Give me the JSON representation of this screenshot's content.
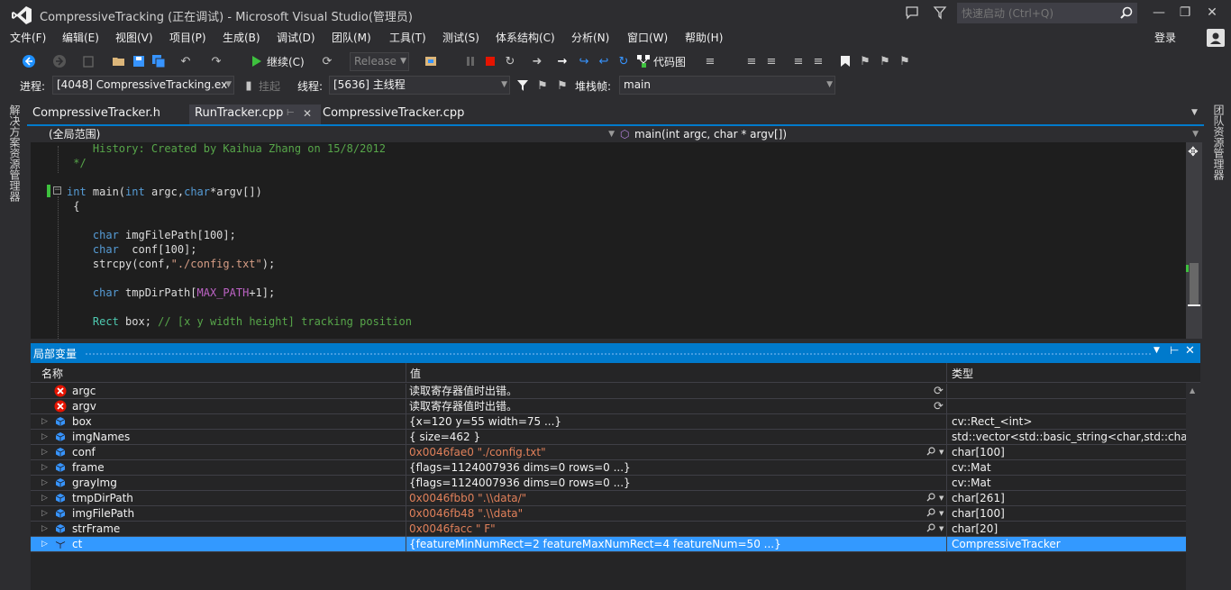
{
  "window": {
    "title": "CompressiveTracking (正在调试) - Microsoft Visual Studio(管理员)",
    "quick_launch_placeholder": "快速启动 (Ctrl+Q)",
    "login": "登录"
  },
  "menu": [
    "文件(F)",
    "编辑(E)",
    "视图(V)",
    "项目(P)",
    "生成(B)",
    "调试(D)",
    "团队(M)",
    "工具(T)",
    "测试(S)",
    "体系结构(C)",
    "分析(N)",
    "窗口(W)",
    "帮助(H)"
  ],
  "toolbar1": {
    "continue_label": "继续(C)",
    "config": "Release",
    "code_map": "代码图"
  },
  "toolbar2": {
    "process_label": "进程:",
    "process_value": "[4048] CompressiveTracking.ex",
    "suspend_label": "挂起",
    "thread_label": "线程:",
    "thread_value": "[5636] 主线程",
    "stack_label": "堆栈帧:",
    "stack_value": "main"
  },
  "side_panels": {
    "left": "解决方案资源管理器",
    "right": "团队资源管理器"
  },
  "tabs": [
    "CompressiveTracker.h",
    "RunTracker.cpp",
    "CompressiveTracker.cpp"
  ],
  "editor_nav": {
    "scope": "(全局范围)",
    "function": "main(int argc, char * argv[])"
  },
  "code": [
    [
      {
        "t": "    History: Created by Kaihua Zhang on 15/8/2012",
        "c": "#57a64a"
      }
    ],
    [
      {
        "t": " */",
        "c": "#57a64a"
      }
    ],
    [
      {
        "t": "",
        "c": "#dcdcdc"
      }
    ],
    [
      {
        "t": "int",
        "c": "#569cd6"
      },
      {
        "t": " main(",
        "c": "#dcdcdc"
      },
      {
        "t": "int",
        "c": "#569cd6"
      },
      {
        "t": " argc,",
        "c": "#dcdcdc"
      },
      {
        "t": "char",
        "c": "#569cd6"
      },
      {
        "t": "*argv[])",
        "c": "#dcdcdc"
      }
    ],
    [
      {
        "t": " {",
        "c": "#dcdcdc"
      }
    ],
    [
      {
        "t": "",
        "c": "#dcdcdc"
      }
    ],
    [
      {
        "t": "    ",
        "c": "#dcdcdc"
      },
      {
        "t": "char",
        "c": "#569cd6"
      },
      {
        "t": " imgFilePath[100];",
        "c": "#dcdcdc"
      }
    ],
    [
      {
        "t": "    ",
        "c": "#dcdcdc"
      },
      {
        "t": "char",
        "c": "#569cd6"
      },
      {
        "t": "  conf[100];",
        "c": "#dcdcdc"
      }
    ],
    [
      {
        "t": "    strcpy(conf,",
        "c": "#dcdcdc"
      },
      {
        "t": "\"./config.txt\"",
        "c": "#d69d85"
      },
      {
        "t": ");",
        "c": "#dcdcdc"
      }
    ],
    [
      {
        "t": "",
        "c": "#dcdcdc"
      }
    ],
    [
      {
        "t": "    ",
        "c": "#dcdcdc"
      },
      {
        "t": "char",
        "c": "#569cd6"
      },
      {
        "t": " tmpDirPath[",
        "c": "#dcdcdc"
      },
      {
        "t": "MAX_PATH",
        "c": "#bd63c5"
      },
      {
        "t": "+1];",
        "c": "#dcdcdc"
      }
    ],
    [
      {
        "t": "",
        "c": "#dcdcdc"
      }
    ],
    [
      {
        "t": "    ",
        "c": "#dcdcdc"
      },
      {
        "t": "Rect",
        "c": "#4ec9b0"
      },
      {
        "t": " box; ",
        "c": "#dcdcdc"
      },
      {
        "t": "// [x y width height] tracking position",
        "c": "#57a64a"
      }
    ]
  ],
  "locals": {
    "title": "局部变量",
    "columns": {
      "name": "名称",
      "value": "值",
      "type": "类型"
    },
    "rows": [
      {
        "name": "argc",
        "value": "读取寄存器值时出错。",
        "type": "",
        "icon": "error",
        "expand": false,
        "red": false,
        "refresh": true,
        "search": false
      },
      {
        "name": "argv",
        "value": "读取寄存器值时出错。",
        "type": "",
        "icon": "error",
        "expand": false,
        "red": false,
        "refresh": true,
        "search": false
      },
      {
        "name": "box",
        "value": "{x=120 y=55 width=75 ...}",
        "type": "cv::Rect_<int>",
        "icon": "var",
        "expand": true,
        "red": false,
        "refresh": false,
        "search": false
      },
      {
        "name": "imgNames",
        "value": "{ size=462 }",
        "type": "std::vector<std::basic_string<char,std::char_traits<ch",
        "icon": "var",
        "expand": true,
        "red": false,
        "refresh": false,
        "search": false
      },
      {
        "name": "conf",
        "value": "0x0046fae0 \"./config.txt\"",
        "type": "char[100]",
        "icon": "var",
        "expand": true,
        "red": true,
        "refresh": false,
        "search": true
      },
      {
        "name": "frame",
        "value": "{flags=1124007936 dims=0 rows=0 ...}",
        "type": "cv::Mat",
        "icon": "var",
        "expand": true,
        "red": false,
        "refresh": false,
        "search": false
      },
      {
        "name": "grayImg",
        "value": "{flags=1124007936 dims=0 rows=0 ...}",
        "type": "cv::Mat",
        "icon": "var",
        "expand": true,
        "red": false,
        "refresh": false,
        "search": false
      },
      {
        "name": "tmpDirPath",
        "value": "0x0046fbb0 \".\\\\data/\"",
        "type": "char[261]",
        "icon": "var",
        "expand": true,
        "red": true,
        "refresh": false,
        "search": true
      },
      {
        "name": "imgFilePath",
        "value": "0x0046fb48 \".\\\\data\"",
        "type": "char[100]",
        "icon": "var",
        "expand": true,
        "red": true,
        "refresh": false,
        "search": true
      },
      {
        "name": "strFrame",
        "value": "0x0046facc \"   F\"",
        "type": "char[20]",
        "icon": "var",
        "expand": true,
        "red": true,
        "refresh": false,
        "search": true
      },
      {
        "name": "ct",
        "value": "{featureMinNumRect=2 featureMaxNumRect=4 featureNum=50 ...}",
        "type": "CompressiveTracker",
        "icon": "var",
        "expand": true,
        "red": false,
        "refresh": false,
        "search": false,
        "selected": true
      }
    ]
  },
  "colors": {
    "accent": "#007acc",
    "bg": "#2d2d30",
    "editor_bg": "#1e1e1e",
    "error": "#e51400"
  }
}
